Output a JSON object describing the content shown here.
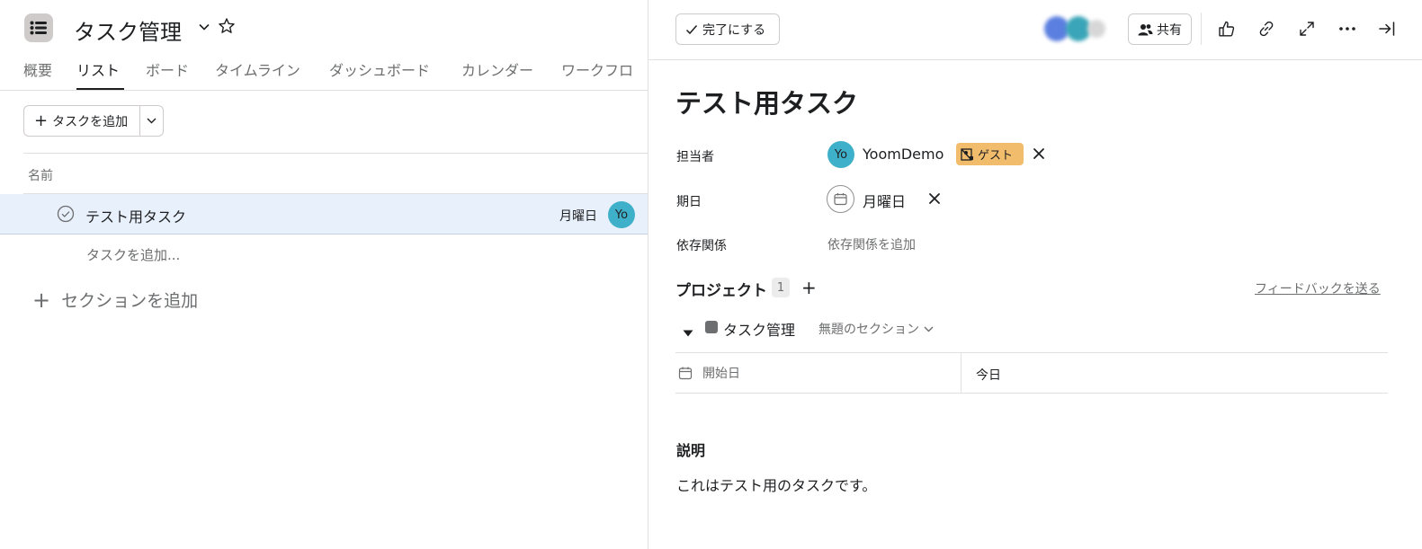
{
  "project": {
    "title": "タスク管理",
    "icon": "list-icon"
  },
  "tabs": [
    {
      "label": "概要",
      "active": false
    },
    {
      "label": "リスト",
      "active": true
    },
    {
      "label": "ボード",
      "active": false
    },
    {
      "label": "タイムライン",
      "active": false
    },
    {
      "label": "ダッシュボード",
      "active": false
    },
    {
      "label": "カレンダー",
      "active": false
    },
    {
      "label": "ワークフロ",
      "active": false
    }
  ],
  "list": {
    "add_task_label": "タスクを追加",
    "column_name": "名前",
    "tasks": [
      {
        "name": "テスト用タスク",
        "due": "月曜日",
        "assignee_initials": "Yo"
      }
    ],
    "add_task_inline": "タスクを追加...",
    "add_section": "セクションを追加"
  },
  "detail": {
    "complete_label": "完了にする",
    "share_label": "共有",
    "title": "テスト用タスク",
    "fields": {
      "assignee_label": "担当者",
      "assignee_initials": "Yo",
      "assignee_name": "YoomDemo",
      "guest_badge": "ゲスト",
      "due_label": "期日",
      "due_value": "月曜日",
      "dependency_label": "依存関係",
      "dependency_add": "依存関係を追加"
    },
    "projects": {
      "label": "プロジェクト",
      "count": "1",
      "add": "+",
      "feedback_link": "フィードバックを送る",
      "item_name": "タスク管理",
      "section_select": "無題のセクション"
    },
    "properties": [
      {
        "label": "開始日",
        "value": "今日"
      }
    ],
    "description": {
      "label": "説明",
      "text": "これはテスト用のタスクです。"
    }
  },
  "colors": {
    "accent_row": "#e8f0fb",
    "avatar": "#3fb0c9",
    "guest_badge": "#f1bd6c"
  }
}
